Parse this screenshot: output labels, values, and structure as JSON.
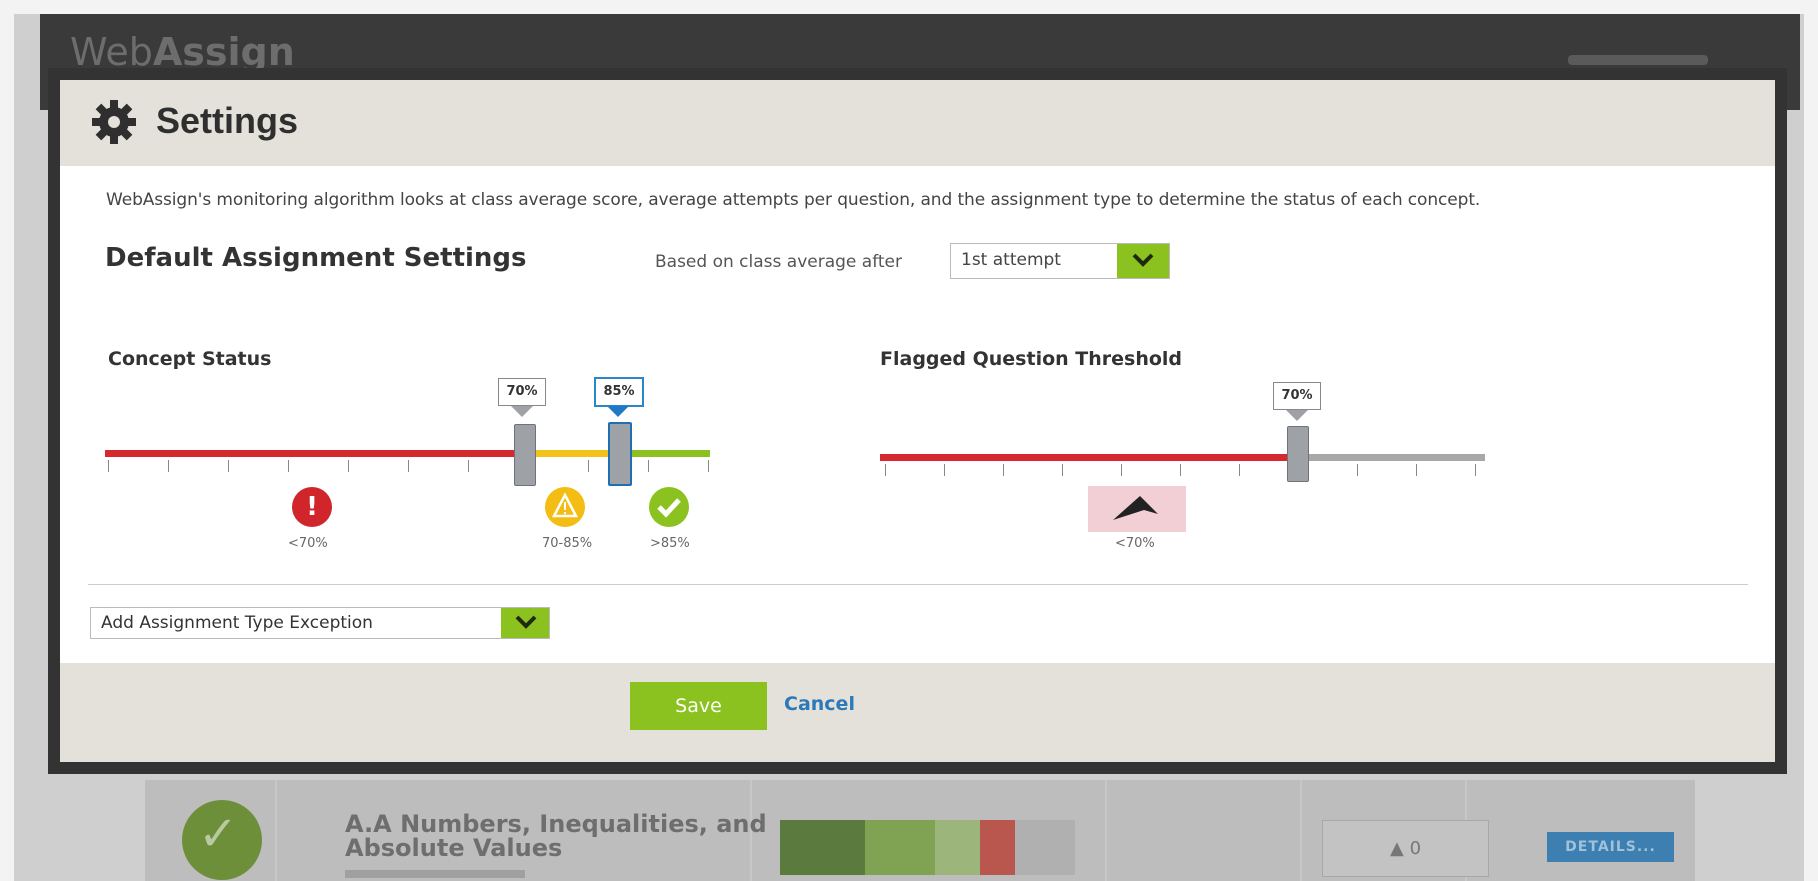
{
  "app": {
    "logo_light": "Web",
    "logo_bold": "Assign"
  },
  "modal": {
    "title": "Settings",
    "description": "WebAssign's monitoring algorithm looks at class average score, average attempts per question, and the assignment type to determine the status of each concept.",
    "section_title": "Default Assignment Settings",
    "based_on_label": "Based on class average after",
    "attempt_select": {
      "value": "1st attempt"
    },
    "concept_status": {
      "label": "Concept Status",
      "low_threshold": "70%",
      "high_threshold": "85%",
      "low_fraction": 0.7,
      "high_fraction": 0.85,
      "statuses": [
        {
          "icon": "!",
          "caption": "<70%",
          "color": "#d0262b"
        },
        {
          "icon": "!",
          "caption": "70-85%",
          "color": "#f3bd13"
        },
        {
          "icon": "✓",
          "caption": ">85%",
          "color": "#8cc21f"
        }
      ]
    },
    "flagged": {
      "label": "Flagged Question Threshold",
      "threshold": "70%",
      "threshold_fraction": 0.7,
      "caption": "<70%"
    },
    "exception_select": {
      "value": "Add Assignment Type Exception"
    },
    "save_label": "Save",
    "cancel_label": "Cancel"
  },
  "background_row": {
    "title": "A.A Numbers, Inequalities, and Absolute Values",
    "flag_count": "0",
    "details_label": "DETAILS..."
  },
  "colors": {
    "red": "#d42a2f",
    "yellow": "#f3c21b",
    "green": "#8cc21f",
    "blue": "#1e7ac7"
  }
}
